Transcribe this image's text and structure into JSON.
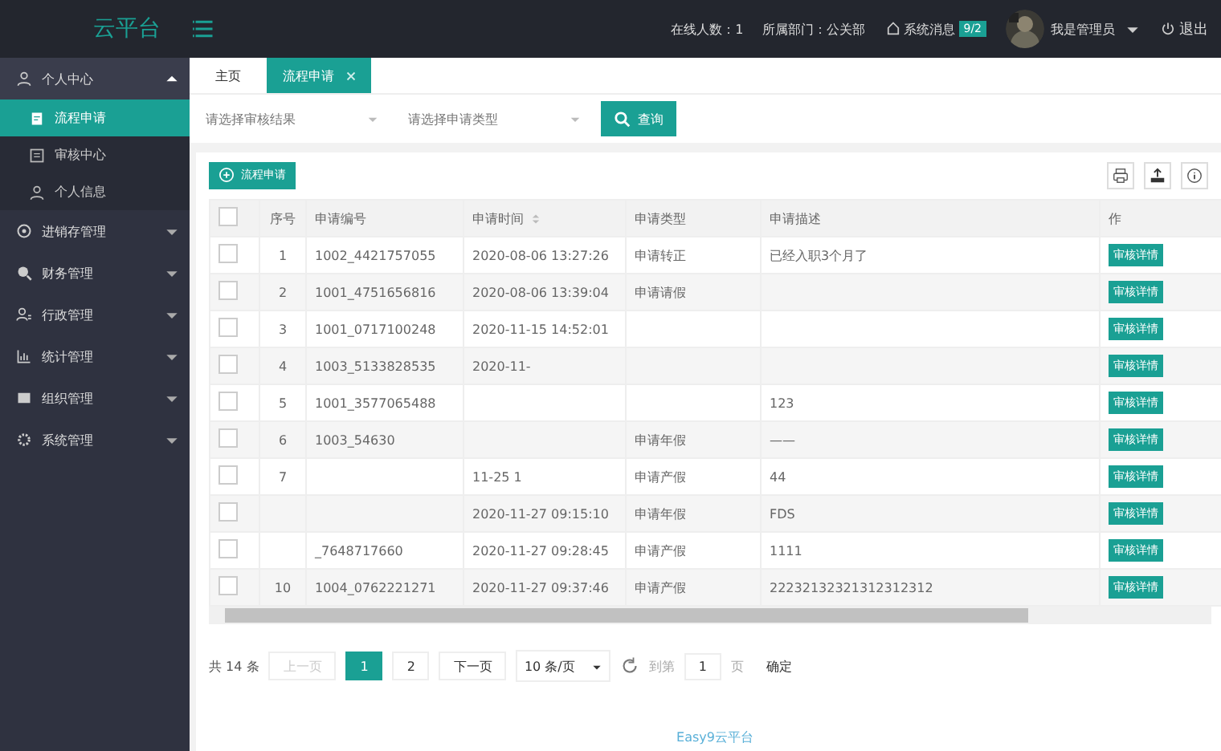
{
  "header": {
    "logo": "云平台",
    "online": "在线人数：1",
    "department": "所属部门：公关部",
    "messages": "系统消息",
    "message_count": "9/2",
    "user": "我是管理员",
    "logout": "退出"
  },
  "sidebar": {
    "items": [
      {
        "label": "个人中心",
        "expanded": true,
        "children": [
          {
            "label": "流程申请",
            "selected": true
          },
          {
            "label": "审核中心",
            "selected": false
          },
          {
            "label": "个人信息",
            "selected": false
          }
        ]
      },
      {
        "label": "进销存管理",
        "expanded": false
      },
      {
        "label": "财务管理",
        "expanded": false
      },
      {
        "label": "行政管理",
        "expanded": false
      },
      {
        "label": "统计管理",
        "expanded": false
      },
      {
        "label": "组织管理",
        "expanded": false
      },
      {
        "label": "系统管理",
        "expanded": false
      }
    ]
  },
  "tabs": [
    {
      "label": "主页",
      "selected": false,
      "closable": false
    },
    {
      "label": "流程申请",
      "selected": true,
      "closable": true
    }
  ],
  "filters": {
    "selects": [
      {
        "placeholder": "请选择审核结果"
      },
      {
        "placeholder": "请选择申请类型"
      }
    ],
    "search_button": "查询"
  },
  "add_button": "流程申请",
  "table": {
    "all_checked": false,
    "columns": [
      "序号",
      "申请编号",
      "申请时间",
      "申请类型",
      "申请描述",
      "作"
    ],
    "rows": [
      {
        "cells": [
          "1",
          "1002_4421757055",
          "2020-08-06 13:27:26",
          "申请转正",
          "已经入职3个月了"
        ],
        "checked": false,
        "action": "审核详情"
      },
      {
        "cells": [
          "2",
          "1001_4751656816",
          "2020-08-06 13:39:04",
          "申请请假",
          ""
        ],
        "checked": false,
        "action": "审核详情"
      },
      {
        "cells": [
          "3",
          "1001_0717100248",
          "2020-11-15 14:52:01",
          "",
          ""
        ],
        "checked": false,
        "action": "审核详情"
      },
      {
        "cells": [
          "4",
          "1003_5133828535",
          "2020-11-",
          "",
          ""
        ],
        "checked": false,
        "action": "审核详情"
      },
      {
        "cells": [
          "5",
          "1001_3577065488",
          "",
          "",
          "123"
        ],
        "checked": false,
        "action": "审核详情"
      },
      {
        "cells": [
          "6",
          "1003_54630",
          "",
          "申请年假",
          "——"
        ],
        "checked": false,
        "action": "审核详情"
      },
      {
        "cells": [
          "7",
          "",
          "11-25 1",
          "申请产假",
          "44"
        ],
        "checked": false,
        "action": "审核详情"
      },
      {
        "cells": [
          "",
          "",
          "2020-11-27 09:15:10",
          "申请年假",
          "FDS"
        ],
        "checked": false,
        "action": "审核详情"
      },
      {
        "cells": [
          "",
          "_7648717660",
          "2020-11-27 09:28:45",
          "申请产假",
          "1111"
        ],
        "checked": false,
        "action": "审核详情"
      },
      {
        "cells": [
          "10",
          "1004_0762221271",
          "2020-11-27 09:37:46",
          "申请产假",
          "22232132321312312312"
        ],
        "checked": false,
        "action": "审核详情"
      }
    ]
  },
  "pagination": {
    "total": "共 14 条",
    "prev": "上一页",
    "pages": [
      {
        "label": "1",
        "selected": true
      },
      {
        "label": "2",
        "selected": false
      }
    ],
    "next": "下一页",
    "page_size": "10 条/页",
    "goto": "到第",
    "page_input": "1",
    "page_unit": "页",
    "confirm": "确定"
  },
  "footer": "Easy9云平台"
}
